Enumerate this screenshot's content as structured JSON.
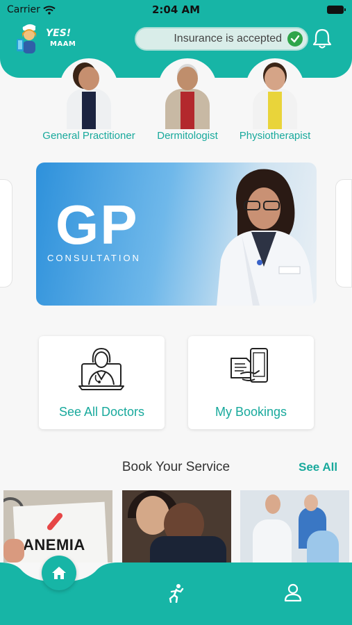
{
  "status_bar": {
    "carrier": "Carrier",
    "time": "2:04 AM"
  },
  "header": {
    "logo": {
      "yes": "YES!",
      "maam": "MAAM"
    },
    "insurance_label": "Insurance is accepted"
  },
  "specialists": [
    {
      "label": "General Practitioner"
    },
    {
      "label": "Dermitologist"
    },
    {
      "label": "Physiotherapist"
    }
  ],
  "banner": {
    "title": "GP",
    "subtitle": "CONSULTATION"
  },
  "actions": {
    "doctors_label": "See All Doctors",
    "bookings_label": "My Bookings"
  },
  "services": {
    "title": "Book Your Service",
    "see_all": "See All",
    "items": [
      {
        "text": "ANEMIA"
      }
    ]
  },
  "colors": {
    "brand_teal": "#17b5a6",
    "text_teal": "#18a99c",
    "check_green": "#2fa54a"
  },
  "icons": {
    "wifi": "wifi-icon",
    "battery": "battery-icon",
    "check": "check-icon",
    "bell": "bell-icon",
    "doctor": "doctor-on-screen-icon",
    "bookings": "mobile-booking-icon",
    "home": "home-icon",
    "activity": "activity-icon",
    "profile": "profile-icon"
  }
}
